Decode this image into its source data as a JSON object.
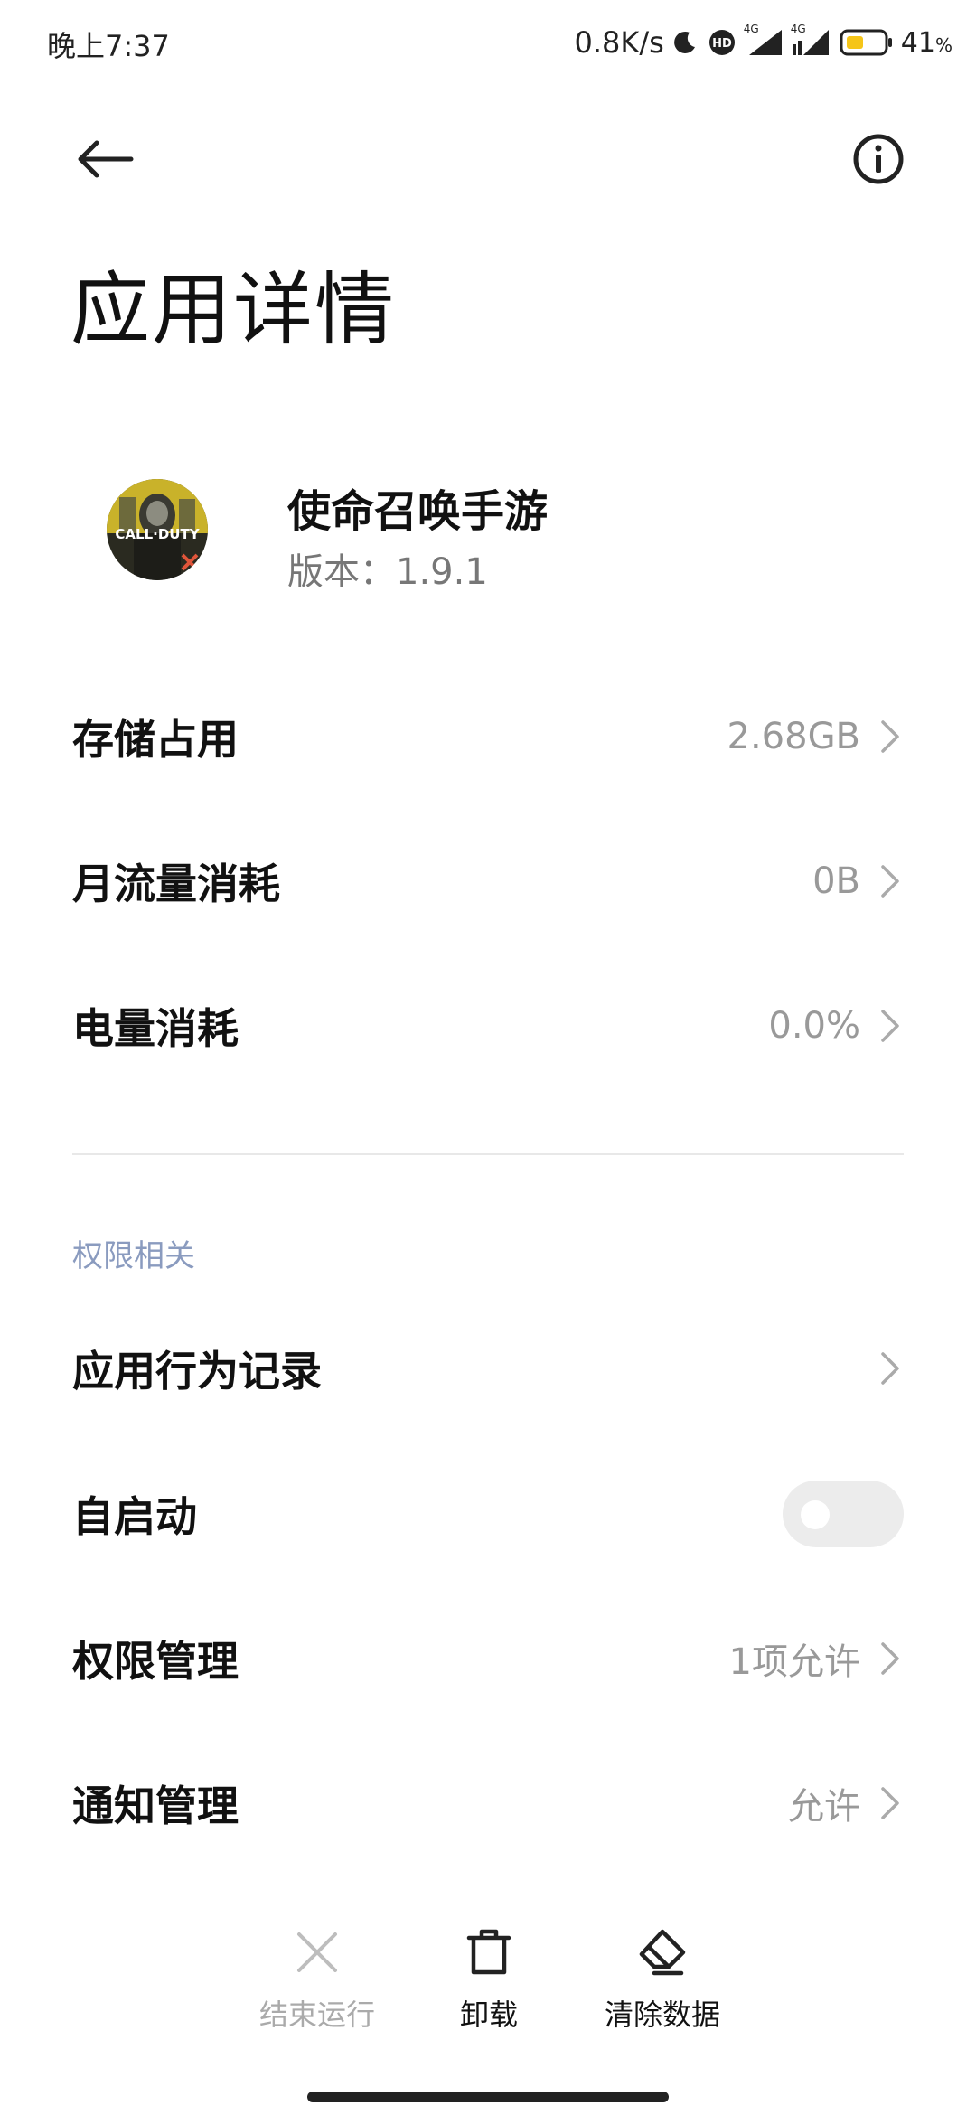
{
  "status_bar": {
    "time": "晚上7:37",
    "network_speed": "0.8K/s",
    "network_label_1": "4G",
    "network_label_2": "4G",
    "battery": "41",
    "battery_unit": "%"
  },
  "header": {
    "back_icon": "arrow-left-icon",
    "info_icon": "info-circle-icon",
    "title": "应用详情"
  },
  "app": {
    "name": "使命召唤手游",
    "version": "版本：1.9.1",
    "icon_text": "CALL·DUTY"
  },
  "rows": {
    "storage": {
      "label": "存储占用",
      "value": "2.68GB"
    },
    "traffic": {
      "label": "月流量消耗",
      "value": "0B"
    },
    "battery": {
      "label": "电量消耗",
      "value": "0.0%"
    }
  },
  "permissions": {
    "section_title": "权限相关",
    "behavior": {
      "label": "应用行为记录",
      "value": ""
    },
    "autostart": {
      "label": "自启动",
      "enabled": false
    },
    "manage": {
      "label": "权限管理",
      "value": "1项允许"
    },
    "notify": {
      "label": "通知管理",
      "value": "允许"
    }
  },
  "actions": {
    "stop": {
      "label": "结束运行",
      "enabled": false,
      "icon": "close-x-icon"
    },
    "uninstall": {
      "label": "卸载",
      "enabled": true,
      "icon": "trash-icon"
    },
    "clear": {
      "label": "清除数据",
      "enabled": true,
      "icon": "eraser-icon"
    }
  },
  "colors": {
    "section_header": "#8a9bbf",
    "secondary_text": "#999999",
    "disabled_text": "#aaaaaa",
    "battery_fill": "#f5c518"
  }
}
